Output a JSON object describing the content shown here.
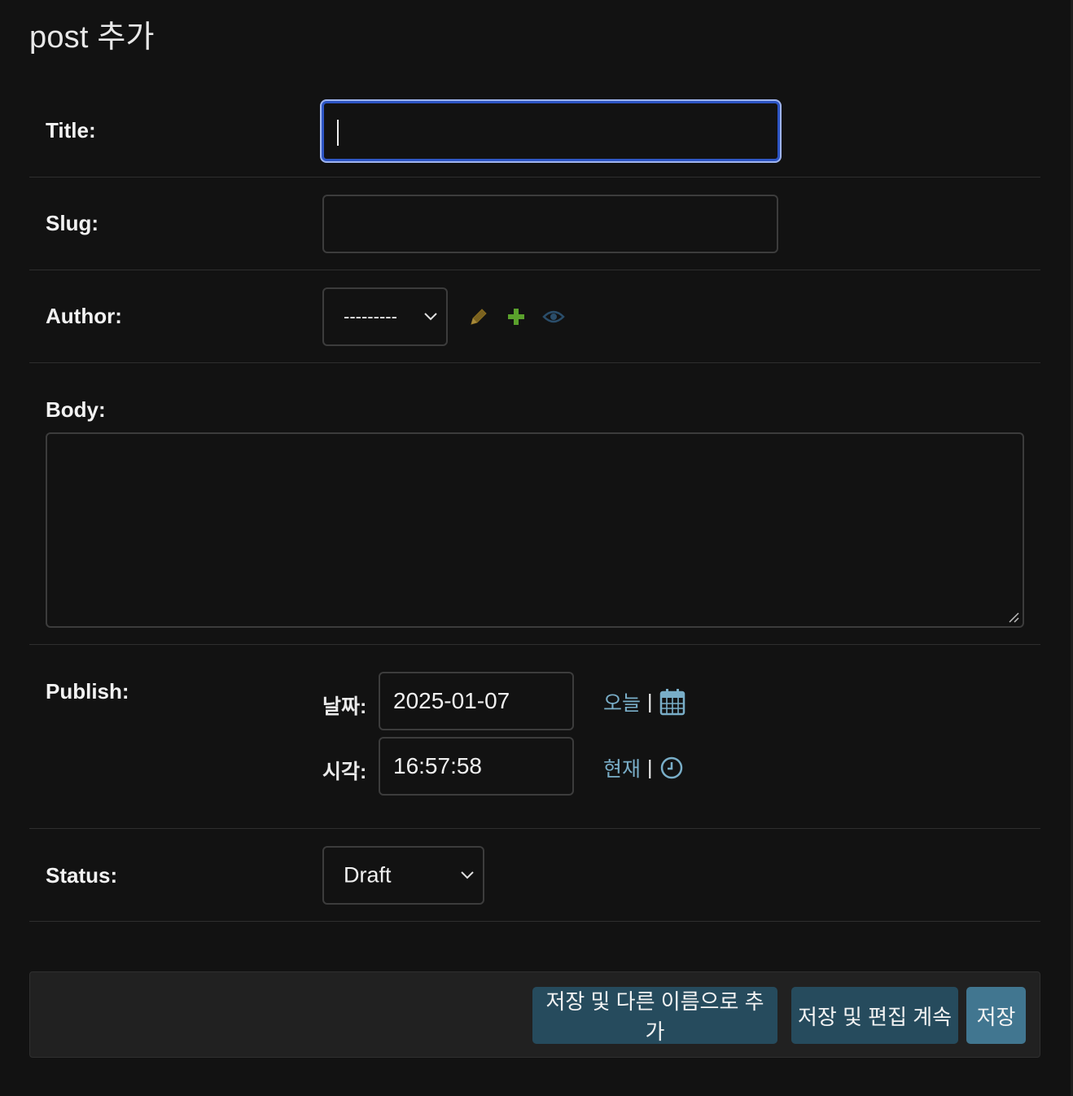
{
  "page_title": "post 추가",
  "form": {
    "title": {
      "label": "Title:",
      "value": ""
    },
    "slug": {
      "label": "Slug:",
      "value": ""
    },
    "author": {
      "label": "Author:",
      "selected": "---------",
      "icons": {
        "change": "pencil-icon",
        "add": "plus-icon",
        "view": "eye-icon"
      }
    },
    "body": {
      "label": "Body:",
      "value": ""
    },
    "publish": {
      "label": "Publish:",
      "date_label": "날짜:",
      "date_value": "2025-01-07",
      "today_link": "오늘",
      "time_label": "시각:",
      "time_value": "16:57:58",
      "now_link": "현재",
      "separator": "|",
      "icons": {
        "calendar": "calendar-icon",
        "clock": "clock-icon"
      }
    },
    "status": {
      "label": "Status:",
      "selected": "Draft"
    }
  },
  "submit": {
    "save_add_another": "저장 및 다른 이름으로 추가",
    "save_continue": "저장 및 편집 계속",
    "save": "저장"
  },
  "colors": {
    "background": "#121212",
    "link": "#79aec8",
    "primary_button": "#417690",
    "secondary_button": "#264b5d",
    "focus_border": "#2d55c4",
    "add_icon": "#5aa02c",
    "change_icon": "#8a6d1e",
    "view_icon": "#2a4d6a"
  }
}
